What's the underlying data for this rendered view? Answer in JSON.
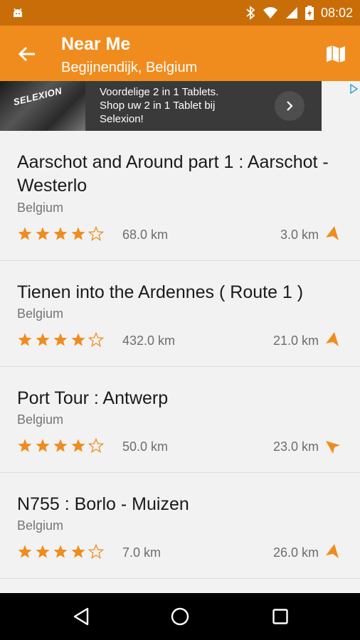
{
  "status_bar": {
    "time": "08:02",
    "icons": [
      "android-icon",
      "bluetooth-icon",
      "wifi-icon",
      "signal-icon",
      "battery-icon"
    ]
  },
  "app_bar": {
    "title": "Near Me",
    "subtitle": "Begijnendijk, Belgium",
    "accent_color": "#f08c1e"
  },
  "ad": {
    "brand_sign": "SELEXION",
    "text_line1": "Voordelige 2 in 1 Tablets.",
    "text_line2": "Shop uw 2 in 1 Tablet bij",
    "text_line3": "Selexion!"
  },
  "routes": [
    {
      "name": "Aarschot and Around part 1 : Aarschot - Westerlo",
      "country": "Belgium",
      "rating": 4,
      "rating_max": 5,
      "length": "68.0 km",
      "distance": "3.0 km"
    },
    {
      "name": "Tienen into the Ardennes ( Route 1 )",
      "country": "Belgium",
      "rating": 4,
      "rating_max": 5,
      "length": "432.0 km",
      "distance": "21.0 km"
    },
    {
      "name": "Port Tour : Antwerp",
      "country": "Belgium",
      "rating": 4,
      "rating_max": 5,
      "length": "50.0 km",
      "distance": "23.0 km"
    },
    {
      "name": "N755 : Borlo - Muizen",
      "country": "Belgium",
      "rating": 4,
      "rating_max": 5,
      "length": "7.0 km",
      "distance": "26.0 km"
    }
  ],
  "nav_bar": {
    "icons": [
      "back-triangle-icon",
      "home-circle-icon",
      "recents-square-icon"
    ]
  }
}
